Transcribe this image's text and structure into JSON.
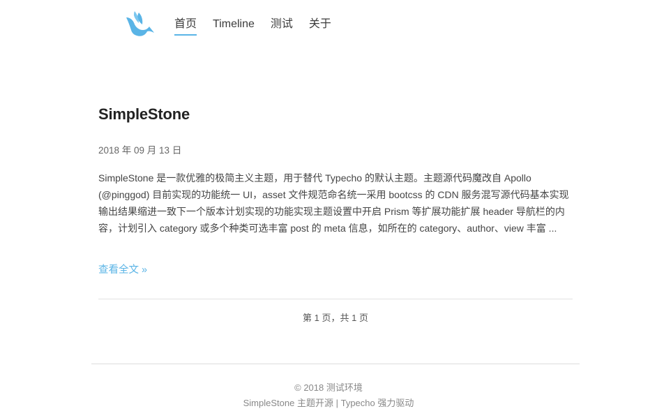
{
  "colors": {
    "accent": "#5ab4e6",
    "logo": "#5ab4e6",
    "text": "#444444"
  },
  "header": {
    "logo_icon": "hummingbird-icon",
    "nav": [
      {
        "label": "首页",
        "active": true
      },
      {
        "label": "Timeline",
        "active": false
      },
      {
        "label": "测试",
        "active": false
      },
      {
        "label": "关于",
        "active": false
      }
    ]
  },
  "post": {
    "title": "SimpleStone",
    "date": "2018 年 09 月 13 日",
    "excerpt": "SimpleStone 是一款优雅的极简主义主题，用于替代 Typecho 的默认主题。主题源代码魔改自 Apollo (@pinggod) 目前实现的功能统一 UI，asset 文件规范命名统一采用 bootcss 的 CDN 服务混写源代码基本实现输出结果缩进一致下一个版本计划实现的功能实现主题设置中开启 Prism 等扩展功能扩展 header 导航栏的内容，计划引入 category 或多个种类可选丰富 post 的 meta 信息，如所在的 category、author、view 丰富 ...",
    "read_more": "查看全文 »"
  },
  "pagination": {
    "text": "第 1 页，共 1 页"
  },
  "footer": {
    "copyright": "© 2018 测试环境",
    "theme_link": "SimpleStone 主题开源",
    "separator": "|",
    "powered_link": "Typecho 强力驱动"
  }
}
